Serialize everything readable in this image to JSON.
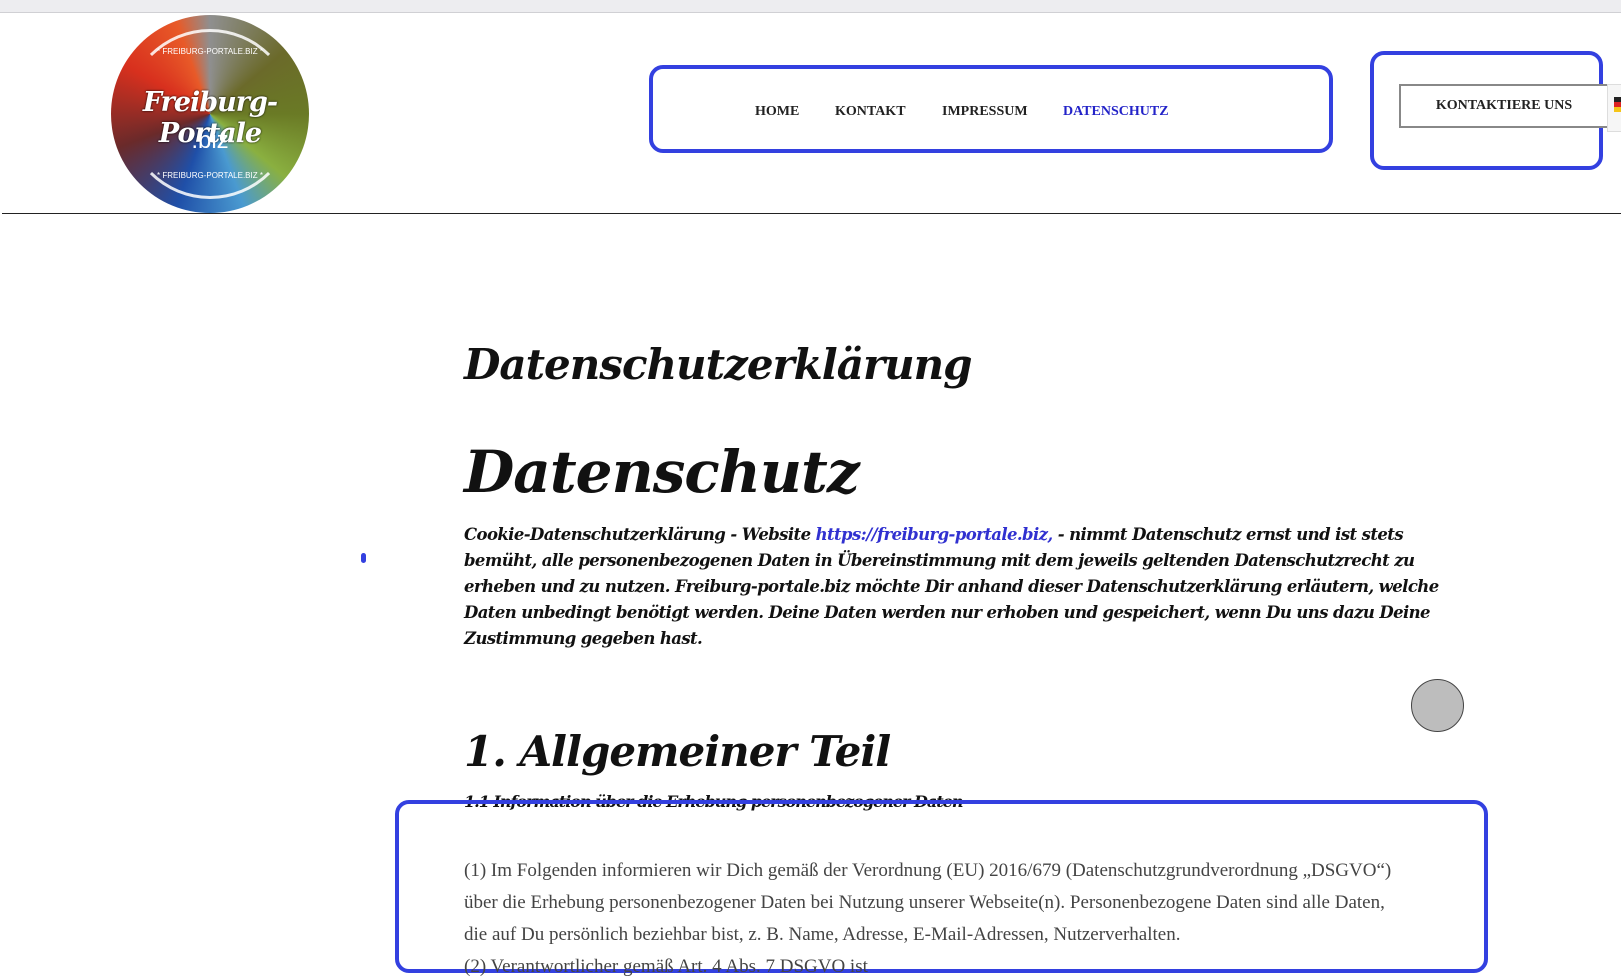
{
  "logo": {
    "title": "Freiburg-Portale",
    "suffix": ".biz",
    "ring_top": "* FREIBURG-PORTALE.BIZ *",
    "ring_bottom": "* FREIBURG-PORTALE.BIZ *"
  },
  "nav": {
    "items": [
      {
        "label": "HOME"
      },
      {
        "label": "KONTAKT"
      },
      {
        "label": "IMPRESSUM"
      },
      {
        "label": "DATENSCHUTZ",
        "active": true
      }
    ],
    "cta": "KONTAKTIERE UNS",
    "language_icon": "german-flag-icon"
  },
  "content": {
    "title": "Datenschutzerklärung",
    "subtitle": "Datenschutz",
    "intro_prefix": "Cookie-Datenschutzerklärung - Website ",
    "intro_link": "https://freiburg-portale.biz,",
    "intro_rest": "  - nimmt Datenschutz ernst und ist stets bemüht, alle personenbezogenen Daten in Übereinstimmung mit dem jeweils geltenden Datenschutzrecht zu erheben und zu nutzen. Freiburg-portale.biz möchte Dir anhand dieser Datenschutzerklärung erläutern, welche Daten unbedingt benötigt werden. Deine Daten werden nur erhoben und gespeichert, wenn Du uns dazu Deine Zustimmung gegeben hast.",
    "section_title": "1. Allgemeiner Teil",
    "subsection_title": "1.1 Information über die Erhebung personenbezogener Daten",
    "paragraph_lines": [
      "(1) Im Folgenden informieren wir Dich gemäß der Verordnung (EU) 2016/679 (Datenschutzgrundverordnung „DSGVO“)",
      "über die Erhebung personenbezogener Daten bei Nutzung unserer Webseite(n). Personenbezogene Daten sind alle Daten,",
      "die auf Du persönlich beziehbar bist, z. B. Name, Adresse, E-Mail-Adressen, Nutzerverhalten.",
      "(2) Verantwortlicher gemäß Art. 4 Abs. 7 DSGVO ist"
    ]
  },
  "colors": {
    "highlight": "#3340e0",
    "active_nav": "#2323c8",
    "link": "#3030d0"
  }
}
